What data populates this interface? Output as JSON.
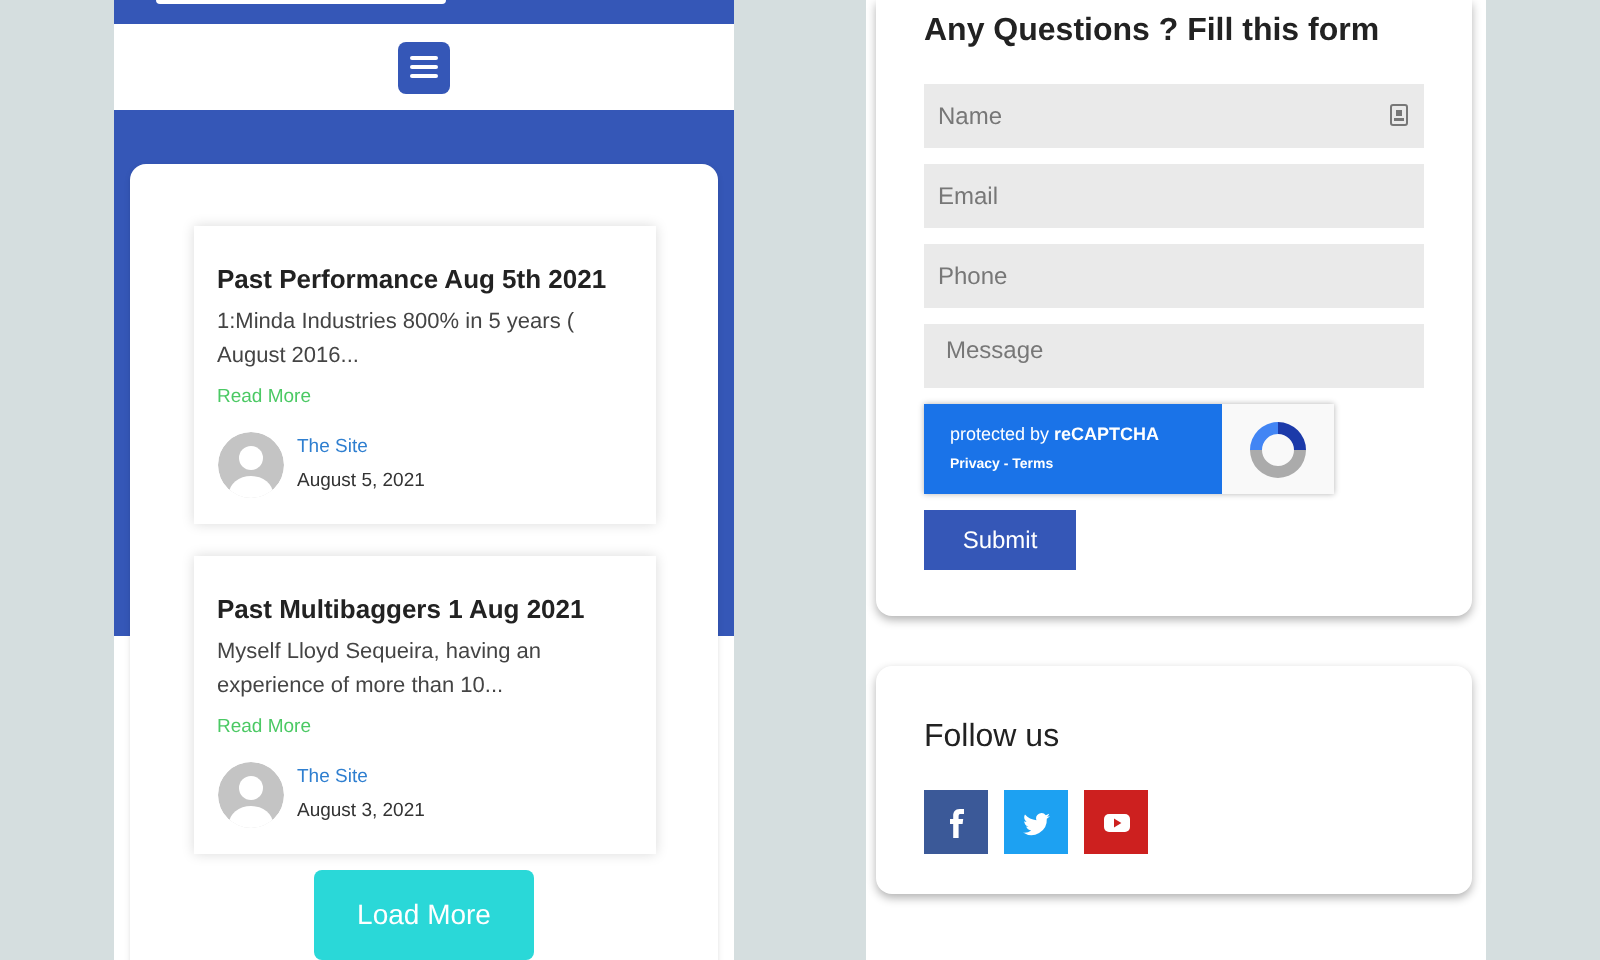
{
  "posts": [
    {
      "title": "Past Performance Aug 5th 2021",
      "excerpt": "1:Minda Industries 800% in 5 years ( August 2016...",
      "read_more": "Read More",
      "author": "The Site",
      "date": "August 5, 2021"
    },
    {
      "title": "Past Multibaggers 1 Aug 2021",
      "excerpt": "Myself Lloyd Sequeira, having an experience of more than 10...",
      "read_more": "Read More",
      "author": "The Site",
      "date": "August 3, 2021"
    }
  ],
  "load_more": "Load More",
  "form": {
    "title": "Any Questions ? Fill this form",
    "fields": [
      {
        "placeholder": "Name",
        "kind": "input"
      },
      {
        "placeholder": "Email",
        "kind": "input"
      },
      {
        "placeholder": "Phone",
        "kind": "input"
      },
      {
        "placeholder": "Message",
        "kind": "textarea"
      }
    ],
    "recaptcha": {
      "label": "protected by **reCAPTCHA**",
      "links": "Privacy - Terms"
    },
    "submit": "Submit"
  },
  "follow": {
    "title": "Follow us",
    "links": [
      {
        "kind": "facebook"
      },
      {
        "kind": "twitter"
      },
      {
        "kind": "youtube"
      }
    ]
  }
}
